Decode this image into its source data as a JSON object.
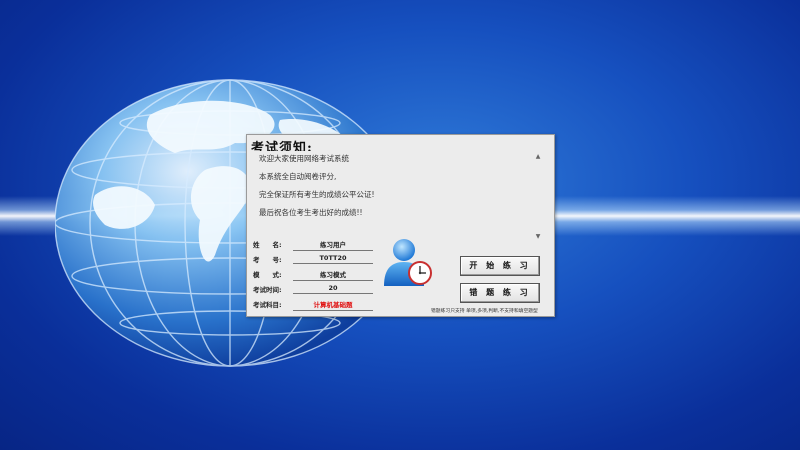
{
  "notice": {
    "title": "考试须知:",
    "lines": [
      "欢迎大家使用网络考试系统",
      "本系统全自动阅卷评分,",
      "完全保证所有考生的成绩公平公证!",
      "最后祝各位考生考出好的成绩!!"
    ]
  },
  "info": {
    "name_label": "姓　　名:",
    "name_value": "练习用户",
    "id_label": "考　　号:",
    "id_value": "T0TT20",
    "mode_label": "模　　式:",
    "mode_value": "练习模式",
    "time_label": "考试时间:",
    "time_value": "20",
    "subject_label": "考试科目:",
    "subject_value": "计算机基础题"
  },
  "buttons": {
    "start": "开 始 练 习",
    "wrong": "错 题 练 习"
  },
  "note": "错题练习只支持 单项,多项,判断,不支持和填空题型",
  "icons": {
    "user": "user-clock-icon",
    "globe": "globe-icon"
  }
}
